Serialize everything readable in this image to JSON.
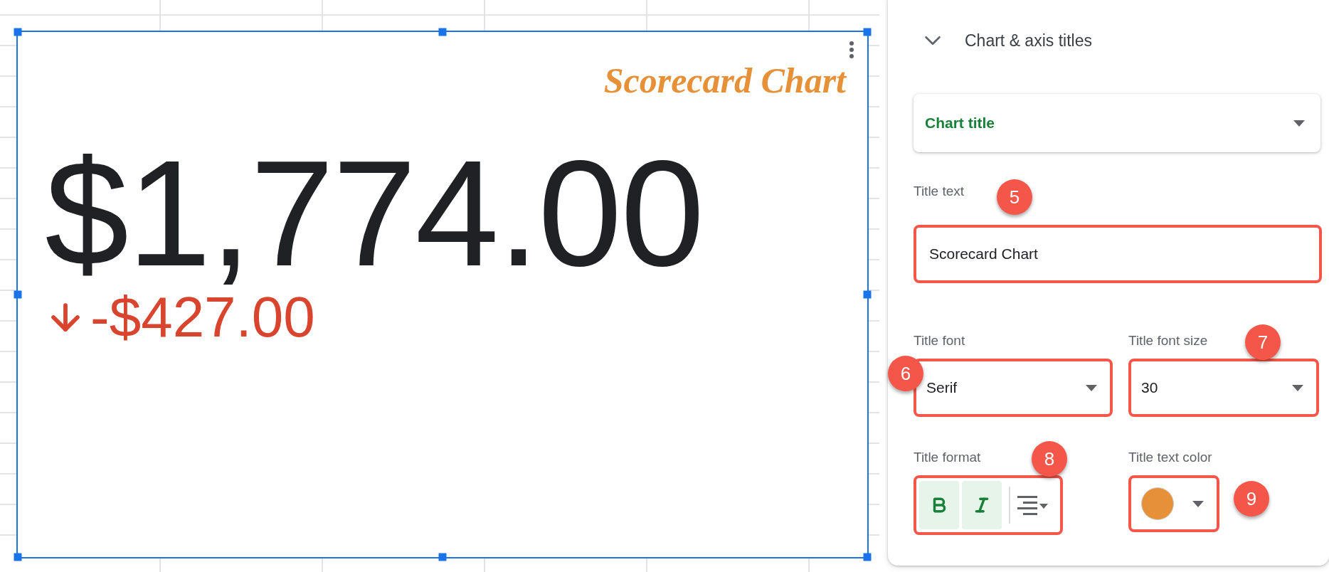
{
  "chart": {
    "title": "Scorecard Chart",
    "value": "$1,774.00",
    "change": {
      "text": "-$427.00",
      "falling": true
    },
    "selected": true
  },
  "panel": {
    "section": {
      "title": "Chart & axis titles",
      "expanded": true
    },
    "title_selector": {
      "value": "Chart title"
    },
    "title_text": {
      "label": "Title text",
      "value": "Scorecard Chart",
      "badge": "5",
      "highlighted": true
    },
    "title_font": {
      "label": "Title font",
      "value": "Serif",
      "badge": "6",
      "highlighted": true
    },
    "title_font_size": {
      "label": "Title font size",
      "value": "30",
      "badge": "7",
      "highlighted": true
    },
    "title_format": {
      "label": "Title format",
      "badge": "8",
      "highlighted": true,
      "bold": true,
      "italic": true
    },
    "title_text_color": {
      "label": "Title text color",
      "color": "#e69138",
      "badge": "9",
      "highlighted": true
    }
  }
}
